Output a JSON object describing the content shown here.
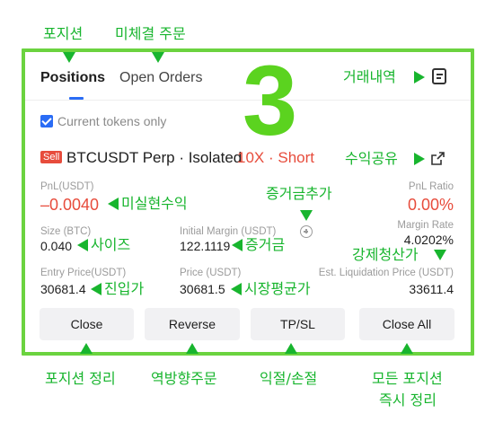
{
  "annotations": {
    "positions_tab": "포지션",
    "open_orders_tab": "미체결 주문",
    "trade_history": "거래내역",
    "share_pnl": "수익공유",
    "unrealized_pnl": "미실현수익",
    "add_margin": "증거금추가",
    "size": "사이즈",
    "margin": "증거금",
    "liquidation_price": "강제청산가",
    "entry_price": "진입가",
    "market_price": "시장평균가",
    "close_btn": "포지션 정리",
    "reverse_btn": "역방향주문",
    "tpsl_btn": "익절/손절",
    "close_all_line1": "모든 포지션",
    "close_all_line2": "즉시 정리"
  },
  "step_number": "3",
  "tabs": [
    {
      "label": "Positions",
      "active": true
    },
    {
      "label": "Open Orders",
      "active": false
    }
  ],
  "filter": {
    "label": "Current tokens only",
    "checked": true
  },
  "position": {
    "side_badge": "Sell",
    "pair": "BTCUSDT Perp · Isolated",
    "leverage": "10X · Short",
    "pnl_label": "PnL(USDT)",
    "pnl_value": "–0.0040",
    "pnl_ratio_label": "PnL Ratio",
    "pnl_ratio_value": "0.00%",
    "size_label": "Size (BTC)",
    "size_value": "0.040",
    "initial_margin_label": "Initial Margin (USDT)",
    "initial_margin_value": "122.1119",
    "margin_rate_label": "Margin Rate",
    "margin_rate_value": "4.0202%",
    "entry_price_label": "Entry Price(USDT)",
    "entry_price_value": "30681.4",
    "price_label": "Price (USDT)",
    "price_value": "30681.5",
    "liq_price_label": "Est. Liquidation Price (USDT)",
    "liq_price_value": "33611.4"
  },
  "buttons": {
    "close": "Close",
    "reverse": "Reverse",
    "tpsl": "TP/SL",
    "close_all": "Close All"
  },
  "colors": {
    "annotation": "#18b52e",
    "frame": "#6bd33f",
    "loss": "#e74c3c",
    "accent": "#2a6cf5"
  }
}
